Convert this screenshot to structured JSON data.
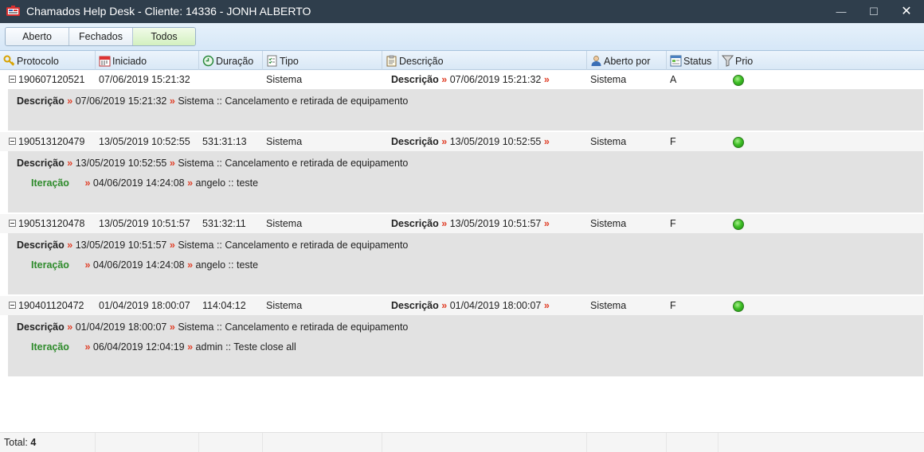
{
  "window": {
    "title": "Chamados Help Desk - Cliente: 14336 - JONH ALBERTO",
    "min_glyph": "—",
    "max_glyph": "☐",
    "close_glyph": "✕"
  },
  "filters": {
    "aberto": "Aberto",
    "fechados": "Fechados",
    "todos": "Todos",
    "active": "Todos"
  },
  "columns": {
    "protocolo": "Protocolo",
    "iniciado": "Iniciado",
    "duracao": "Duração",
    "tipo": "Tipo",
    "descricao": "Descrição",
    "aberto_por": "Aberto por",
    "status": "Status",
    "prio": "Prio"
  },
  "arrow": "»",
  "tickets": [
    {
      "protocolo": "190607120521",
      "iniciado": "07/06/2019 15:21:32",
      "duracao": "",
      "tipo": "Sistema",
      "desc_label": "Descrição",
      "desc_date": "07/06/2019 15:21:32",
      "aberto_por": "Sistema",
      "status": "A",
      "detail": {
        "label": "Descrição",
        "date": "07/06/2019 15:21:32",
        "text": "Sistema :: Cancelamento e retirada de equipamento"
      },
      "iteracao": null
    },
    {
      "protocolo": "190513120479",
      "iniciado": "13/05/2019 10:52:55",
      "duracao": "531:31:13",
      "tipo": "Sistema",
      "desc_label": "Descrição",
      "desc_date": "13/05/2019 10:52:55",
      "aberto_por": "Sistema",
      "status": "F",
      "detail": {
        "label": "Descrição",
        "date": "13/05/2019 10:52:55",
        "text": "Sistema :: Cancelamento e retirada de equipamento"
      },
      "iteracao": {
        "label": "Iteração",
        "date": "04/06/2019 14:24:08",
        "text": "angelo :: teste"
      }
    },
    {
      "protocolo": "190513120478",
      "iniciado": "13/05/2019 10:51:57",
      "duracao": "531:32:11",
      "tipo": "Sistema",
      "desc_label": "Descrição",
      "desc_date": "13/05/2019 10:51:57",
      "aberto_por": "Sistema",
      "status": "F",
      "detail": {
        "label": "Descrição",
        "date": "13/05/2019 10:51:57",
        "text": "Sistema :: Cancelamento e retirada de equipamento"
      },
      "iteracao": {
        "label": "Iteração",
        "date": "04/06/2019 14:24:08",
        "text": "angelo :: teste"
      }
    },
    {
      "protocolo": "190401120472",
      "iniciado": "01/04/2019 18:00:07",
      "duracao": "114:04:12",
      "tipo": "Sistema",
      "desc_label": "Descrição",
      "desc_date": "01/04/2019 18:00:07",
      "aberto_por": "Sistema",
      "status": "F",
      "detail": {
        "label": "Descrição",
        "date": "01/04/2019 18:00:07",
        "text": "Sistema :: Cancelamento e retirada de equipamento"
      },
      "iteracao": {
        "label": "Iteração",
        "date": "06/04/2019 12:04:19",
        "text": "admin :: Teste close all"
      }
    }
  ],
  "footer": {
    "total_label": "Total:",
    "total_value": "4"
  },
  "colors": {
    "titlebar": "#2f3e4c",
    "detail_bg": "#e2e2e2",
    "arrow": "#e0412a",
    "iteracao": "#2d8a2a",
    "prio_dot": "#3fbf26"
  }
}
